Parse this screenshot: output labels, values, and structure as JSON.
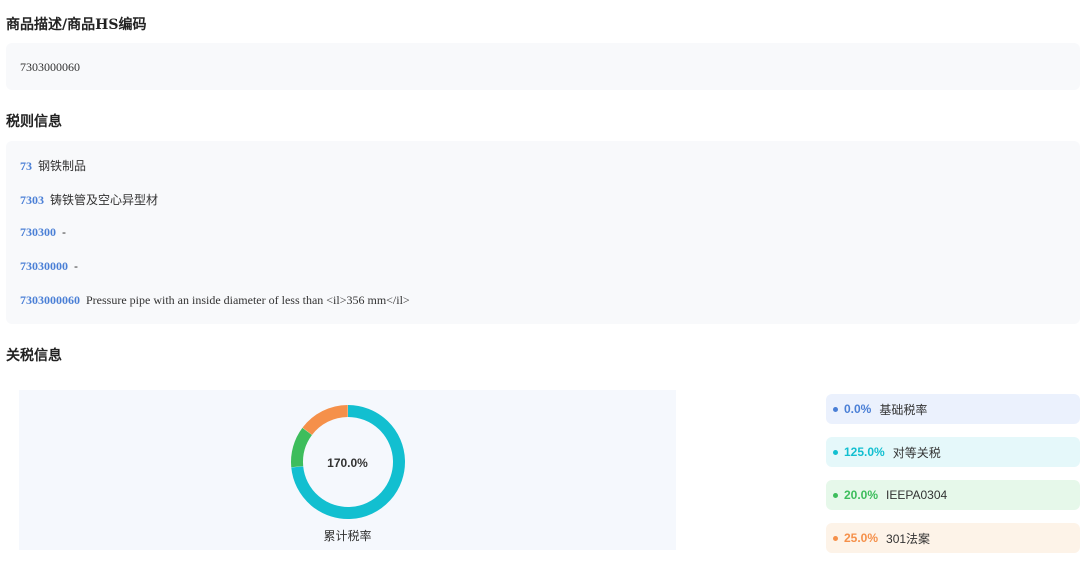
{
  "sections": {
    "hs": {
      "title": "商品描述/商品HS编码",
      "value": "7303000060"
    },
    "tariff": {
      "title": "税则信息",
      "rows": [
        {
          "code": "73",
          "desc": "钢铁制品"
        },
        {
          "code": "7303",
          "desc": "铸铁管及空心异型材"
        },
        {
          "code": "730300",
          "desc": "-"
        },
        {
          "code": "73030000",
          "desc": "-"
        },
        {
          "code": "7303000060",
          "desc": "Pressure pipe with an inside diameter of less than <il>356 mm</il>"
        }
      ]
    },
    "duty": {
      "title": "关税信息",
      "total": "170.0%",
      "caption": "累计税率",
      "items": [
        {
          "value": "0.0%",
          "label": "基础税率",
          "rate": 0.0,
          "color": "#4a7fd6",
          "bg": "#ebf1fd"
        },
        {
          "value": "125.0%",
          "label": "对等关税",
          "rate": 125.0,
          "color": "#12bfd0",
          "bg": "#e5f8fa"
        },
        {
          "value": "20.0%",
          "label": "IEEPA0304",
          "rate": 20.0,
          "color": "#3dbd5c",
          "bg": "#e6f8ea"
        },
        {
          "value": "25.0%",
          "label": "301法案",
          "rate": 25.0,
          "color": "#f5904a",
          "bg": "#fdf3e8"
        }
      ]
    }
  }
}
